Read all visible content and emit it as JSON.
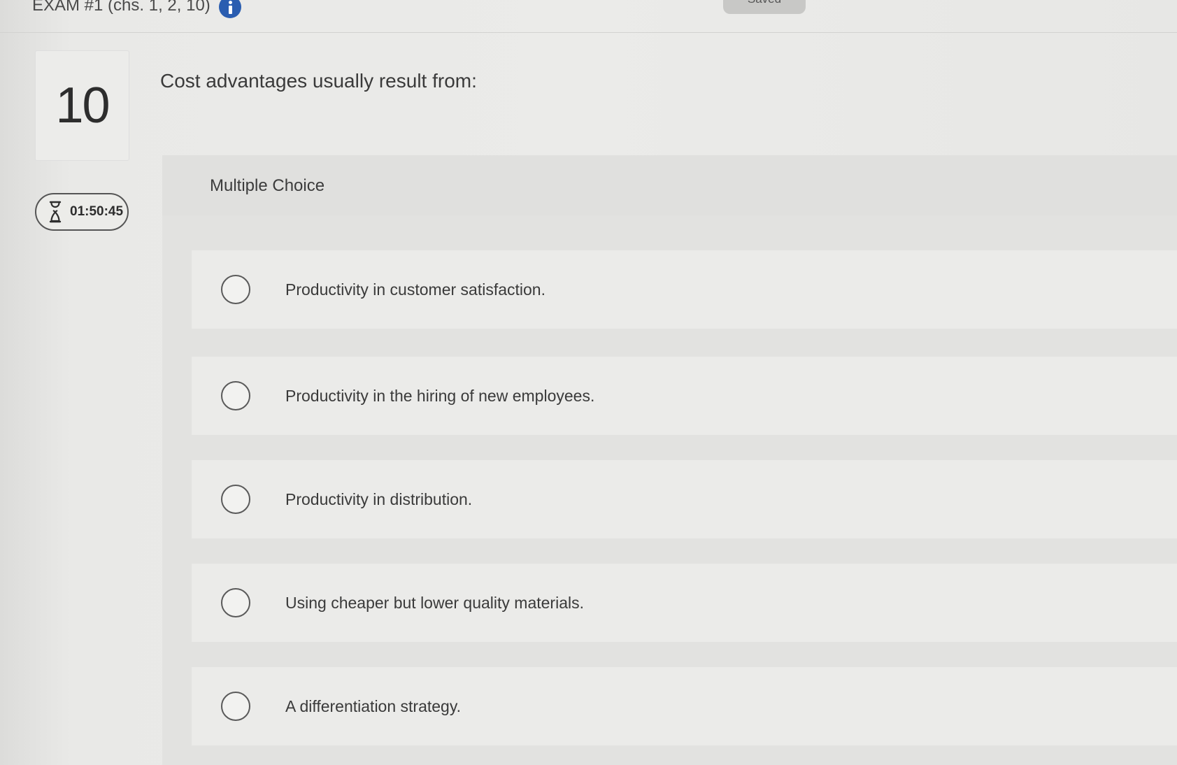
{
  "header": {
    "exam_title": "EXAM #1 (chs. 1, 2, 10)",
    "saved_label": "Saved"
  },
  "question": {
    "number": "10",
    "text": "Cost advantages usually result from:",
    "type_label": "Multiple Choice"
  },
  "timer": {
    "remaining": "01:50:45"
  },
  "options": [
    {
      "label": "Productivity in customer satisfaction."
    },
    {
      "label": "Productivity in the hiring of new employees."
    },
    {
      "label": "Productivity in distribution."
    },
    {
      "label": "Using cheaper but lower quality materials."
    },
    {
      "label": "A differentiation strategy."
    }
  ],
  "colors": {
    "info_icon": "#2a5db0",
    "background": "#e9e9e7",
    "option_background": "#ebebe9"
  },
  "icons": {
    "info": "info-icon",
    "timer": "hourglass-icon",
    "option": "radio-circle-icon"
  }
}
